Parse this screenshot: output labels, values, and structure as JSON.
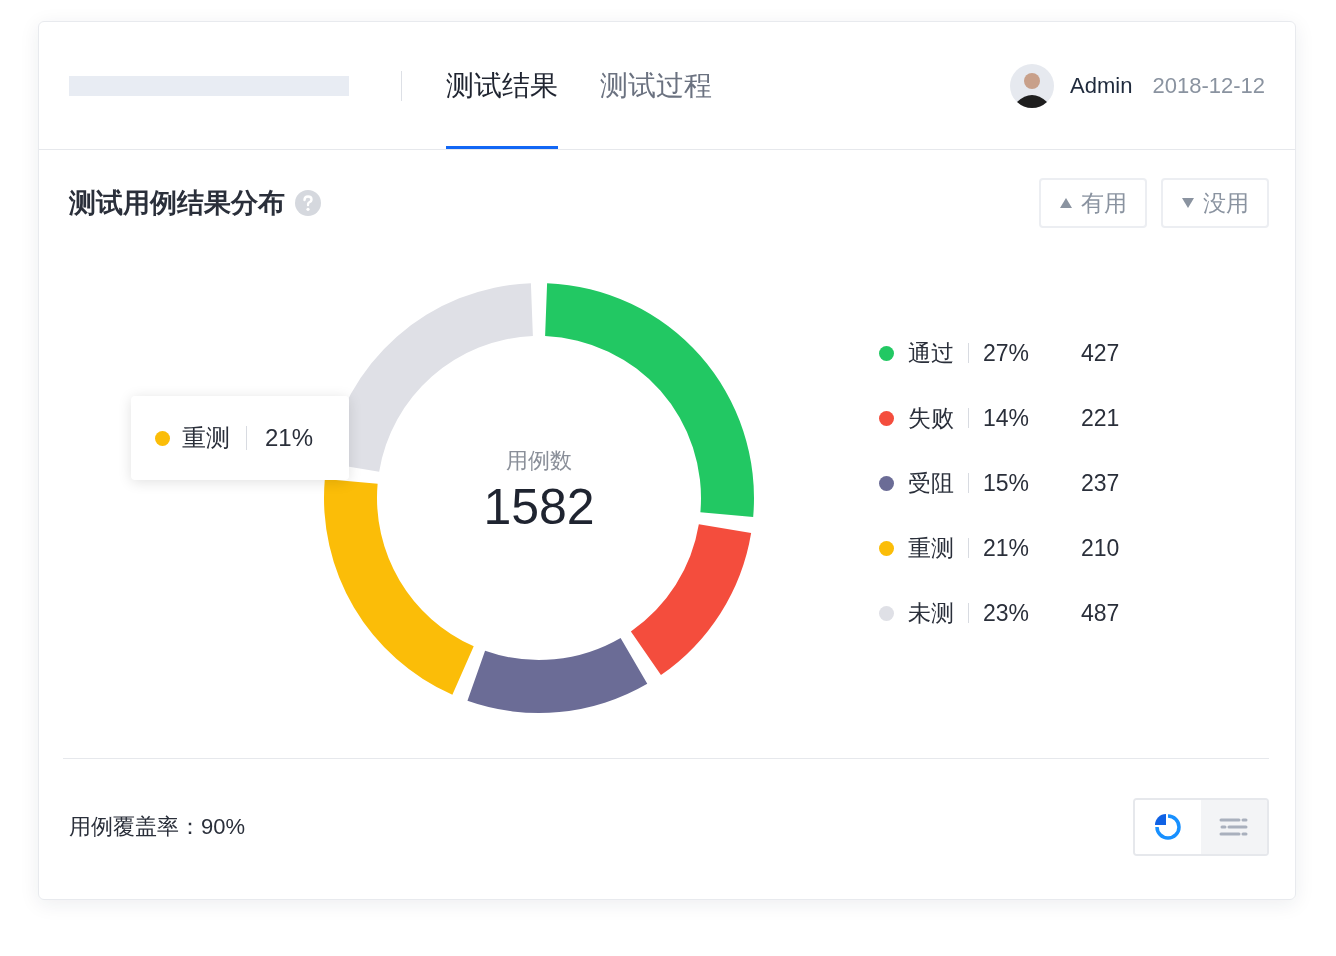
{
  "tabs": [
    {
      "label": "测试结果",
      "selected": true
    },
    {
      "label": "测试过程",
      "selected": false
    }
  ],
  "user": {
    "name": "Admin",
    "date": "2018-12-12"
  },
  "panel": {
    "title": "测试用例结果分布",
    "vote_buttons": [
      {
        "label": "有用",
        "kind": "up"
      },
      {
        "label": "没用",
        "kind": "down"
      }
    ],
    "center_label": "用例数",
    "center_value": "1582",
    "chart_data": {
      "type": "donut",
      "values": [
        27,
        14,
        15,
        21,
        23
      ]
    },
    "tooltip": {
      "label": "重测",
      "percent": "21%",
      "color": "#fbbd08"
    },
    "legend": [
      {
        "label": "通过",
        "percent": "27%",
        "count": "427",
        "color": "#22c863"
      },
      {
        "label": "失败",
        "percent": "14%",
        "count": "221",
        "color": "#f44d3d"
      },
      {
        "label": "受阻",
        "percent": "15%",
        "count": "237",
        "color": "#6b6c96"
      },
      {
        "label": "重测",
        "percent": "21%",
        "count": "210",
        "color": "#fbbd08"
      },
      {
        "label": "未测",
        "percent": "23%",
        "count": "487",
        "color": "#dfe0e6"
      }
    ]
  },
  "footer": {
    "coverage": "用例覆盖率：90%",
    "view_toggle": [
      {
        "kind": "chart",
        "selected": true
      },
      {
        "kind": "list",
        "selected": false
      }
    ]
  }
}
